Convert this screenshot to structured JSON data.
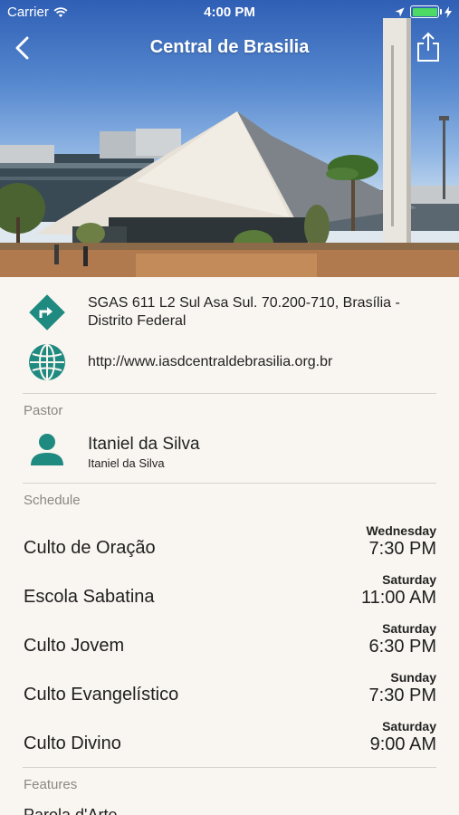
{
  "status_bar": {
    "carrier": "Carrier",
    "time": "4:00 PM"
  },
  "nav": {
    "title": "Central de Brasilia",
    "back_icon": "chevron-left-icon",
    "share_icon": "share-icon"
  },
  "location": {
    "address": "SGAS 611 L2 Sul Asa Sul. 70.200-710, Brasília - Distrito Federal",
    "website": "http://www.iasdcentraldebrasilia.org.br"
  },
  "pastor": {
    "section_label": "Pastor",
    "name": "Itaniel da Silva",
    "subtitle": "Itaniel da Silva"
  },
  "schedule": {
    "section_label": "Schedule",
    "items": [
      {
        "name": "Culto de Oração",
        "day": "Wednesday",
        "time": "7:30 PM"
      },
      {
        "name": "Escola Sabatina",
        "day": "Saturday",
        "time": "11:00 AM"
      },
      {
        "name": "Culto Jovem",
        "day": "Saturday",
        "time": "6:30 PM"
      },
      {
        "name": "Culto Evangelístico",
        "day": "Sunday",
        "time": "7:30 PM"
      },
      {
        "name": "Culto Divino",
        "day": "Saturday",
        "time": "9:00 AM"
      }
    ]
  },
  "features": {
    "section_label": "Features",
    "items": [
      "Parola d'Arte"
    ]
  },
  "colors": {
    "accent": "#1f8a80",
    "background": "#f9f6f1",
    "divider": "#d6d3ce",
    "section_label": "#8a8784"
  }
}
